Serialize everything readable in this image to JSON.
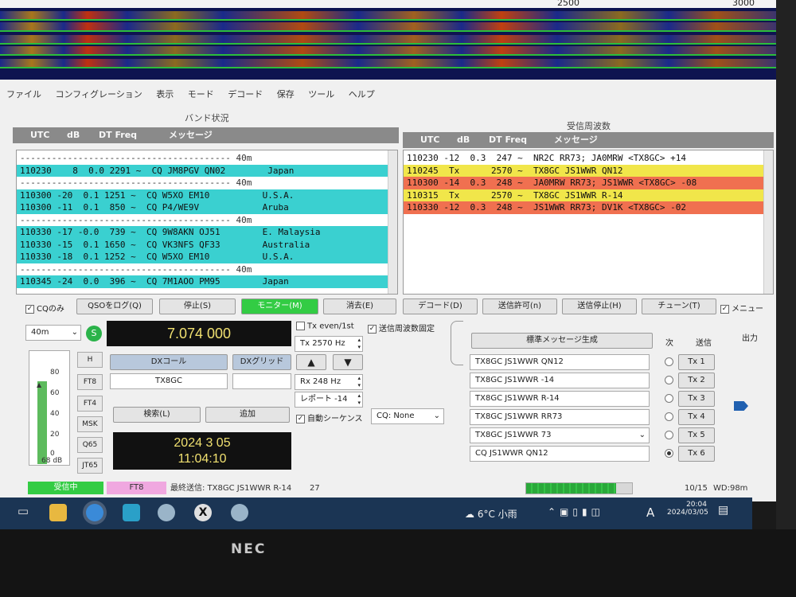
{
  "waterfall": {
    "scale_labels": [
      "2500",
      "3000"
    ]
  },
  "menu": [
    "ファイル",
    "コンフィグレーション",
    "表示",
    "モード",
    "デコード",
    "保存",
    "ツール",
    "ヘルプ"
  ],
  "band_activity": {
    "title": "バンド状況",
    "headers": [
      "UTC",
      "dB",
      "DT Freq",
      "メッセージ"
    ],
    "rows": [
      {
        "text": "---------------------------------------- 40m",
        "style": "sep"
      },
      {
        "text": "110230    8  0.0 2291 ~  CQ JM8PGV QN02        Japan",
        "style": "cq"
      },
      {
        "text": "---------------------------------------- 40m",
        "style": "sep"
      },
      {
        "text": "110300 -20  0.1 1251 ~  CQ W5XO EM10          U.S.A.",
        "style": "cq"
      },
      {
        "text": "110300 -11  0.1  850 ~  CQ P4/WE9V            Aruba",
        "style": "cq"
      },
      {
        "text": "---------------------------------------- 40m",
        "style": "sep"
      },
      {
        "text": "110330 -17 -0.0  739 ~  CQ 9W8AKN OJ51        E. Malaysia",
        "style": "cq"
      },
      {
        "text": "110330 -15  0.1 1650 ~  CQ VK3NFS QF33        Australia",
        "style": "cq"
      },
      {
        "text": "110330 -18  0.1 1252 ~  CQ W5XO EM10          U.S.A.",
        "style": "cq"
      },
      {
        "text": "---------------------------------------- 40m",
        "style": "sep"
      },
      {
        "text": "110345 -24  0.0  396 ~  CQ 7M1AOO PM95        Japan",
        "style": "cq"
      }
    ]
  },
  "rx_frequency": {
    "title": "受信周波数",
    "headers": [
      "UTC",
      "dB",
      "DT Freq",
      "メッセージ"
    ],
    "rows": [
      {
        "text": "110230 -12  0.3  247 ~  NR2C RR73; JA0MRW <TX8GC> +14",
        "style": "plain"
      },
      {
        "text": "110245  Tx      2570 ~  TX8GC JS1WWR QN12",
        "style": "tx"
      },
      {
        "text": "110300 -14  0.3  248 ~  JA0MRW RR73; JS1WWR <TX8GC> -08",
        "style": "red"
      },
      {
        "text": "110315  Tx      2570 ~  TX8GC JS1WWR R-14",
        "style": "tx"
      },
      {
        "text": "110330 -12  0.3  248 ~  JS1WWR RR73; DV1K <TX8GC> -02",
        "style": "red"
      }
    ]
  },
  "controls": {
    "cq_only": "CQのみ",
    "log_qso": "QSOをログ(Q)",
    "stop": "停止(S)",
    "monitor": "モニター(M)",
    "erase": "消去(E)",
    "decode": "デコード(D)",
    "enable_tx": "送信許可(n)",
    "halt_tx": "送信停止(H)",
    "tune": "チューン(T)",
    "menu": "メニュー"
  },
  "left": {
    "band": "40m",
    "s_label": "S",
    "frequency": "7.074 000",
    "meter_ticks": [
      "80",
      "60",
      "40",
      "20",
      "0"
    ],
    "meter_db": "68 dB",
    "modes": [
      "H",
      "FT8",
      "FT4",
      "MSK",
      "Q65",
      "JT65"
    ],
    "dx_call_label": "DXコール",
    "dx_grid_label": "DXグリッド",
    "dx_call": "TX8GC",
    "dx_grid": "",
    "lookup": "検索(L)",
    "add": "追加",
    "date": "2024 3 05",
    "time": "11:04:10"
  },
  "mid": {
    "tx_even": "Tx even/1st",
    "hold_tx": "送信周波数固定",
    "tx_freq": "Tx  2570  Hz",
    "rx_freq": "Rx  248  Hz",
    "report": "レポート -14",
    "auto_seq": "自動シーケンス",
    "cq_select": "CQ: None"
  },
  "messages": {
    "generate": "標準メッセージ生成",
    "next_label": "次",
    "send_label": "送信",
    "items": [
      {
        "text": "TX8GC JS1WWR QN12",
        "tx": "Tx 1"
      },
      {
        "text": "TX8GC JS1WWR -14",
        "tx": "Tx 2"
      },
      {
        "text": "TX8GC JS1WWR R-14",
        "tx": "Tx 3"
      },
      {
        "text": "TX8GC JS1WWR RR73",
        "tx": "Tx 4"
      },
      {
        "text": "TX8GC JS1WWR 73",
        "tx": "Tx 5"
      },
      {
        "text": "CQ JS1WWR QN12",
        "tx": "Tx 6"
      }
    ],
    "power_label": "出力"
  },
  "status": {
    "receiving": "受信中",
    "mode": "FT8",
    "last_tx": "最終送信: TX8GC JS1WWR R-14",
    "count": "27",
    "progress": 0.85,
    "period": "10/15",
    "wd": "WD:98m"
  },
  "taskbar": {
    "weather": "6°C 小雨",
    "time": "20:04",
    "date": "2024/03/05",
    "ime": "A"
  },
  "bezel": {
    "brand": "NEC"
  }
}
